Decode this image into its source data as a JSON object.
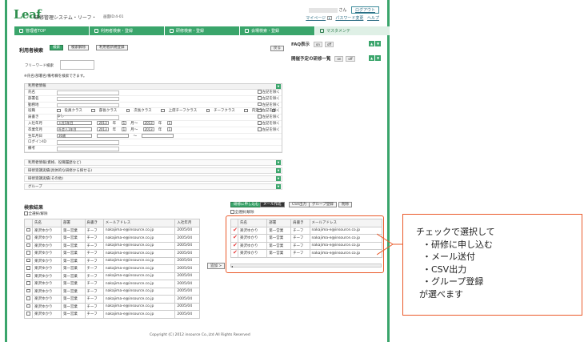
{
  "header": {
    "logo": "Leaf",
    "system_title": "研修管理システム・リーフ・",
    "screen_no": "画面ID:4-01",
    "user_suffix": "さん",
    "logout": "ログアウト",
    "mypage": "マイページ",
    "password_change": "パスワード変更",
    "help": "ヘルプ"
  },
  "nav": {
    "tabs": [
      {
        "label": "管理者TOP"
      },
      {
        "label": "利用者検索・登録"
      },
      {
        "label": "研修検索・登録"
      },
      {
        "label": "会場検索・登録"
      },
      {
        "label": "マスタメンテ"
      }
    ]
  },
  "search": {
    "title": "利用者検索",
    "search_btn": "検索",
    "clear_btn": "検索解除",
    "bulk_btn": "利用者新規登録",
    "back_btn": "戻る",
    "free_word_label": "フリーワード検索",
    "note": "※氏名/部署名/備考欄を検索できます。"
  },
  "right": {
    "faq": "FAQ表示",
    "upcoming": "開催予定の研修一覧",
    "toggle_on": "on",
    "toggle_off": "off"
  },
  "conditions": {
    "header": "利用者情報",
    "except_label": "左記を除く",
    "rows": [
      {
        "label": "氏名"
      },
      {
        "label": "部署名"
      },
      {
        "label": "勤務地"
      },
      {
        "label": "役職"
      },
      {
        "label": "肩書き"
      },
      {
        "label": "入社年月"
      },
      {
        "label": "卒業年月"
      },
      {
        "label": "生年月日"
      },
      {
        "label": "ログインID"
      },
      {
        "label": "備考"
      }
    ],
    "position_options": [
      "役員クラス",
      "部長クラス",
      "次長クラス",
      "上席チーフクラス",
      "チーフクラス",
      "内定者",
      "なし"
    ],
    "hire_select": "入社5年目",
    "grad_select": "社会人1年目",
    "birth_select": "30歳",
    "year": "2013",
    "month": "1",
    "year_unit": "年",
    "month_unit": "月",
    "from_to": "月〜",
    "tilde": "〜",
    "sections": [
      "利用者情報(資格、役職履歴など)",
      "研修受講実績(具体的な研修から探せる)",
      "研修受講実績(その他)",
      "グループ"
    ]
  },
  "results": {
    "title": "検索結果",
    "select_all": "全選択/解除",
    "columns": [
      "氏名",
      "部署",
      "肩書き",
      "メールアドレス",
      "入社年月"
    ],
    "rows": [
      [
        "楽沢ゆかり",
        "第一営業",
        "チーフ",
        "nakajima-e@insource.co.jp",
        "2005/04"
      ],
      [
        "楽沢ゆかり",
        "第一営業",
        "チーフ",
        "nakajima-e@insource.co.jp",
        "2005/04"
      ],
      [
        "楽沢ゆかり",
        "第一営業",
        "チーフ",
        "nakajima-e@insource.co.jp",
        "2005/04"
      ],
      [
        "楽沢ゆかり",
        "第一営業",
        "チーフ",
        "nakajima-e@insource.co.jp",
        "2005/04"
      ],
      [
        "楽沢ゆかり",
        "第一営業",
        "チーフ",
        "nakajima-e@insource.co.jp",
        "2005/04"
      ],
      [
        "楽沢ゆかり",
        "第一営業",
        "チーフ",
        "nakajima-e@insource.co.jp",
        "2005/04"
      ],
      [
        "楽沢ゆかり",
        "第一営業",
        "チーフ",
        "nakajima-e@insource.co.jp",
        "2005/04"
      ],
      [
        "楽沢ゆかり",
        "第一営業",
        "チーフ",
        "nakajima-e@insource.co.jp",
        "2005/04"
      ],
      [
        "楽沢ゆかり",
        "第一営業",
        "チーフ",
        "nakajima-e@insource.co.jp",
        "2005/04"
      ],
      [
        "楽沢ゆかり",
        "第一営業",
        "チーフ",
        "nakajima-e@insource.co.jp",
        "2005/04"
      ],
      [
        "楽沢ゆかり",
        "第一営業",
        "チーフ",
        "nakajima-e@insource.co.jp",
        "2005/04"
      ],
      [
        "楽沢ゆかり",
        "第一営業",
        "チーフ",
        "nakajima-e@insource.co.jp",
        "2005/04"
      ]
    ],
    "add_btn": "追加 >",
    "selected_toggle": "全選択/解除",
    "actions": [
      "研修に申し込む",
      "メール作成",
      "CSV出力",
      "グループ登録",
      "削除"
    ],
    "selected_rows": [
      [
        "楽沢ゆかり",
        "第一営業",
        "チーフ",
        "nakajima-e@insource.co.jp"
      ],
      [
        "楽沢ゆかり",
        "第一営業",
        "チーフ",
        "nakajima-e@insource.co.jp"
      ],
      [
        "楽沢ゆかり",
        "第一営業",
        "チーフ",
        "nakajima-e@insource.co.jp"
      ],
      [
        "楽沢ゆかり",
        "第一営業",
        "チーフ",
        "nakajima-e@insource.co.jp"
      ]
    ]
  },
  "footer": "Copyright (C) 2012 insource Co.,Ltd All Rights Reserved",
  "callout": {
    "lines": [
      "チェックで選択して",
      "・研修に申し込む",
      "・メール送付",
      "・CSV出力",
      "・グループ登録",
      "が選べます"
    ]
  },
  "colors": {
    "brand": "#3aa56b",
    "accent": "#ea5a2a"
  }
}
